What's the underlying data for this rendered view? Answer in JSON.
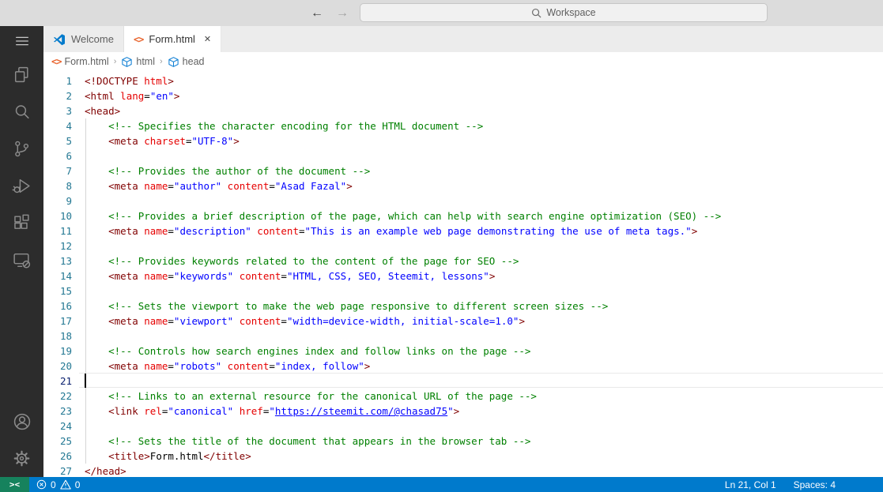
{
  "colors": {
    "accent": "#007acc",
    "remote": "#16825d",
    "activity": "#2c2c2c",
    "titlebar": "#dcdcdc",
    "tabstrip": "#ececec",
    "tag": "#800000",
    "attr": "#e50000",
    "str": "#0000ff",
    "com": "#008000",
    "ln": "#237893",
    "ln_active": "#0b216f",
    "guide": "#d5d5d5",
    "orange": "#e8632c",
    "cube": "#0f7fd4",
    "logo": "#007acc"
  },
  "titlebar": {
    "search_placeholder": "Workspace",
    "back_arrow": "←",
    "forward_arrow": "→"
  },
  "activity_bar": {
    "items": [
      "menu",
      "explorer",
      "search",
      "source-control",
      "run-and-debug",
      "extensions",
      "remote-explorer"
    ],
    "bottom_items": [
      "accounts",
      "settings"
    ]
  },
  "tabs": [
    {
      "label": "Welcome",
      "icon": "vscode-logo",
      "active": false
    },
    {
      "label": "Form.html",
      "icon": "html-file",
      "active": true,
      "close_glyph": "✕"
    }
  ],
  "html_icon_glyph": "<>",
  "breadcrumb": {
    "items": [
      {
        "label": "Form.html",
        "icon": "html-file"
      },
      {
        "label": "html",
        "icon": "symbol-cube"
      },
      {
        "label": "head",
        "icon": "symbol-cube"
      }
    ],
    "separator": "›"
  },
  "editor": {
    "start_line": 1,
    "cursor_line": 21,
    "cursor_col": 1,
    "lines": [
      {
        "ind": 0,
        "tokens": [
          [
            "tag",
            "<!DOCTYPE"
          ],
          [
            "attr",
            " html"
          ],
          [
            "tag",
            ">"
          ]
        ]
      },
      {
        "ind": 0,
        "tokens": [
          [
            "tag",
            "<html"
          ],
          [
            "attr",
            " lang"
          ],
          [
            "eq",
            "="
          ],
          [
            "str",
            "\"en\""
          ],
          [
            "tag",
            ">"
          ]
        ]
      },
      {
        "ind": 0,
        "tokens": [
          [
            "tag",
            "<head>"
          ]
        ]
      },
      {
        "ind": 1,
        "tokens": [
          [
            "com",
            "<!-- Specifies the character encoding for the HTML document -->"
          ]
        ]
      },
      {
        "ind": 1,
        "tokens": [
          [
            "tag",
            "<meta"
          ],
          [
            "attr",
            " charset"
          ],
          [
            "eq",
            "="
          ],
          [
            "str",
            "\"UTF-8\""
          ],
          [
            "tag",
            ">"
          ]
        ]
      },
      {
        "ind": 0,
        "tokens": []
      },
      {
        "ind": 1,
        "tokens": [
          [
            "com",
            "<!-- Provides the author of the document -->"
          ]
        ]
      },
      {
        "ind": 1,
        "tokens": [
          [
            "tag",
            "<meta"
          ],
          [
            "attr",
            " name"
          ],
          [
            "eq",
            "="
          ],
          [
            "str",
            "\"author\""
          ],
          [
            "attr",
            " content"
          ],
          [
            "eq",
            "="
          ],
          [
            "str",
            "\"Asad Fazal\""
          ],
          [
            "tag",
            ">"
          ]
        ]
      },
      {
        "ind": 0,
        "tokens": []
      },
      {
        "ind": 1,
        "tokens": [
          [
            "com",
            "<!-- Provides a brief description of the page, which can help with search engine optimization (SEO) -->"
          ]
        ]
      },
      {
        "ind": 1,
        "tokens": [
          [
            "tag",
            "<meta"
          ],
          [
            "attr",
            " name"
          ],
          [
            "eq",
            "="
          ],
          [
            "str",
            "\"description\""
          ],
          [
            "attr",
            " content"
          ],
          [
            "eq",
            "="
          ],
          [
            "str",
            "\"This is an example web page demonstrating the use of meta tags.\""
          ],
          [
            "tag",
            ">"
          ]
        ]
      },
      {
        "ind": 0,
        "tokens": []
      },
      {
        "ind": 1,
        "tokens": [
          [
            "com",
            "<!-- Provides keywords related to the content of the page for SEO -->"
          ]
        ]
      },
      {
        "ind": 1,
        "tokens": [
          [
            "tag",
            "<meta"
          ],
          [
            "attr",
            " name"
          ],
          [
            "eq",
            "="
          ],
          [
            "str",
            "\"keywords\""
          ],
          [
            "attr",
            " content"
          ],
          [
            "eq",
            "="
          ],
          [
            "str",
            "\"HTML, CSS, SEO, Steemit, lessons\""
          ],
          [
            "tag",
            ">"
          ]
        ]
      },
      {
        "ind": 0,
        "tokens": []
      },
      {
        "ind": 1,
        "tokens": [
          [
            "com",
            "<!-- Sets the viewport to make the web page responsive to different screen sizes -->"
          ]
        ]
      },
      {
        "ind": 1,
        "tokens": [
          [
            "tag",
            "<meta"
          ],
          [
            "attr",
            " name"
          ],
          [
            "eq",
            "="
          ],
          [
            "str",
            "\"viewport\""
          ],
          [
            "attr",
            " content"
          ],
          [
            "eq",
            "="
          ],
          [
            "str",
            "\"width=device-width, initial-scale=1.0\""
          ],
          [
            "tag",
            ">"
          ]
        ]
      },
      {
        "ind": 0,
        "tokens": []
      },
      {
        "ind": 1,
        "tokens": [
          [
            "com",
            "<!-- Controls how search engines index and follow links on the page -->"
          ]
        ]
      },
      {
        "ind": 1,
        "tokens": [
          [
            "tag",
            "<meta"
          ],
          [
            "attr",
            " name"
          ],
          [
            "eq",
            "="
          ],
          [
            "str",
            "\"robots\""
          ],
          [
            "attr",
            " content"
          ],
          [
            "eq",
            "="
          ],
          [
            "str",
            "\"index, follow\""
          ],
          [
            "tag",
            ">"
          ]
        ]
      },
      {
        "ind": 0,
        "tokens": []
      },
      {
        "ind": 1,
        "tokens": [
          [
            "com",
            "<!-- Links to an external resource for the canonical URL of the page -->"
          ]
        ]
      },
      {
        "ind": 1,
        "tokens": [
          [
            "tag",
            "<link"
          ],
          [
            "attr",
            " rel"
          ],
          [
            "eq",
            "="
          ],
          [
            "str",
            "\"canonical\""
          ],
          [
            "attr",
            " href"
          ],
          [
            "eq",
            "="
          ],
          [
            "str",
            "\""
          ],
          [
            "link",
            "https://steemit.com/@chasad75"
          ],
          [
            "str",
            "\""
          ],
          [
            "tag",
            ">"
          ]
        ]
      },
      {
        "ind": 0,
        "tokens": []
      },
      {
        "ind": 1,
        "tokens": [
          [
            "com",
            "<!-- Sets the title of the document that appears in the browser tab -->"
          ]
        ]
      },
      {
        "ind": 1,
        "tokens": [
          [
            "tag",
            "<title>"
          ],
          [
            "txt",
            "Form.html"
          ],
          [
            "tag",
            "</title>"
          ]
        ]
      },
      {
        "ind": 0,
        "tokens": [
          [
            "tag",
            "</head>"
          ]
        ]
      }
    ]
  },
  "status_bar": {
    "remote_glyph": "><",
    "errors": "0",
    "warnings": "0",
    "line_col": "Ln 21, Col 1",
    "spaces": "Spaces: 4"
  }
}
